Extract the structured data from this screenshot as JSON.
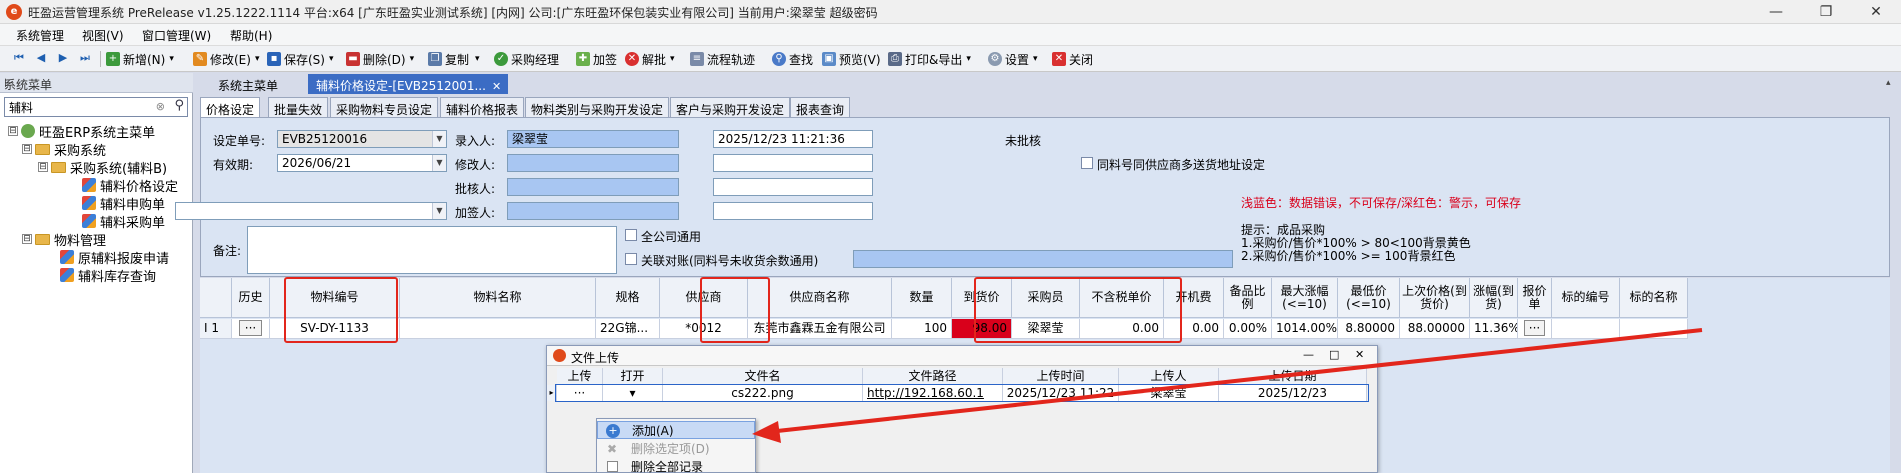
{
  "window": {
    "title": "旺盈运营管理系统 PreRelease v1.25.1222.1114 平台:x64  [广东旺盈实业测试系统] [内网] 公司:[广东旺盈环保包装实业有限公司] 当前用户:梁翠莹  超级密码",
    "controls": [
      "—",
      "❐",
      "✕"
    ]
  },
  "menu": [
    "系统管理",
    "视图(V)",
    "窗口管理(W)",
    "帮助(H)"
  ],
  "toolbar": {
    "new": "新增(N)",
    "edit": "修改(E)",
    "save": "保存(S)",
    "delete": "删除(D)",
    "copy": "复制",
    "purchase_manager": "采购经理",
    "sign": "加签",
    "unlock": "解批",
    "flow": "流程轨迹",
    "find": "查找",
    "preview": "预览(V)",
    "print": "打印&导出",
    "settings": "设置",
    "close": "关闭"
  },
  "left_panel": {
    "title": "系统菜单",
    "pin": "⊢",
    "search_value": "辅料",
    "tree": [
      {
        "label": "旺盈ERP系统主菜单",
        "level": 0,
        "type": "root",
        "expander": "⊟"
      },
      {
        "label": "采购系统",
        "level": 1,
        "type": "folder",
        "expander": "⊟"
      },
      {
        "label": "采购系统(辅料B)",
        "level": 2,
        "type": "folder",
        "expander": "⊟"
      },
      {
        "label": "辅料价格设定",
        "level": 3,
        "type": "leaf"
      },
      {
        "label": "辅料申购单",
        "level": 3,
        "type": "leaf"
      },
      {
        "label": "辅料采购单",
        "level": 3,
        "type": "leaf"
      },
      {
        "label": "物料管理",
        "level": 1,
        "type": "folder",
        "expander": "⊟"
      },
      {
        "label": "原辅料报废申请",
        "level": 2,
        "type": "leaf"
      },
      {
        "label": "辅料库存查询",
        "level": 2,
        "type": "leaf"
      }
    ]
  },
  "doc_tabs": [
    "系统主菜单",
    "辅料价格设定-[EVB2512001...",
    "✕"
  ],
  "sub_tabs": [
    "价格设定",
    "批量失效",
    "采购物料专员设定",
    "辅料价格报表",
    "物料类别与采购开发设定",
    "客户与采购开发设定",
    "报表查询"
  ],
  "form": {
    "setting_no_label": "设定单号:",
    "setting_no": "EVB25120016",
    "valid_label": "有效期:",
    "valid_date": "2026/06/21",
    "entry_label": "录入人:",
    "entry_person": "梁翠莹",
    "modifier_label": "修改人:",
    "approver_label": "批核人:",
    "signer_label": "加签人:",
    "entry_time": "2025/12/23 11:21:36",
    "status": "未批核",
    "same_item_label": "同料号同供应商多送货地址设定",
    "color_hint": "浅蓝色：数据错误，不可保存/深红色：警示，可保存",
    "tips_title": "提示：成品采购",
    "tip1": "1.采购价/售价*100% > 80<100背景黄色",
    "tip2": "2.采购价/售价*100% >= 100背景红色",
    "remark_label": "备注:",
    "company_wide": "全公司通用",
    "related_check": "关联对账(同料号未收货余数通用)"
  },
  "grid": {
    "headers": [
      "历史",
      "物料编号",
      "物料名称",
      "规格",
      "供应商",
      "供应商名称",
      "数量",
      "到货价",
      "采购员",
      "不含税单价",
      "开机费",
      "备品比例",
      "最大涨幅(<=10)",
      "最低价(<=10)",
      "上次价格(到货价)",
      "涨幅(到货)",
      "报价单",
      "标的编号",
      "标的名称"
    ],
    "row": {
      "indicator": "I 1",
      "history": "···",
      "material_code": "SV-DY-1133",
      "material_name": "",
      "spec": "22G锦...",
      "supplier": "*0012",
      "supplier_name": "东莞市鑫霖五金有限公司",
      "qty": "100",
      "arrival_price": "98.00",
      "buyer": "梁翠莹",
      "unit_price": "0.00",
      "setup_fee": "0.00",
      "spare_ratio": "0.00%",
      "max_rise": "1014.00%",
      "min_price": "8.80000",
      "last_price": "88.00000",
      "rise": "11.36%",
      "quote": "···"
    }
  },
  "dialog": {
    "title": "文件上传",
    "controls": [
      "—",
      "□",
      "✕"
    ],
    "headers": [
      "上传",
      "打开",
      "文件名",
      "文件路径",
      "上传时间",
      "上传人",
      "上传日期"
    ],
    "row": {
      "upload": "···",
      "open": "▾",
      "filename": "cs222.png",
      "path": "http://192.168.60.1",
      "time": "2025/12/23 11:22",
      "uploader": "梁翠莹",
      "date": "2025/12/23"
    }
  },
  "context_menu": [
    "添加(A)",
    "删除选定项(D)",
    "删除全部记录"
  ],
  "colors": {
    "accent_red": "#e2261c",
    "field_blue": "#a8c6f2",
    "warning_red": "#d9001b"
  }
}
